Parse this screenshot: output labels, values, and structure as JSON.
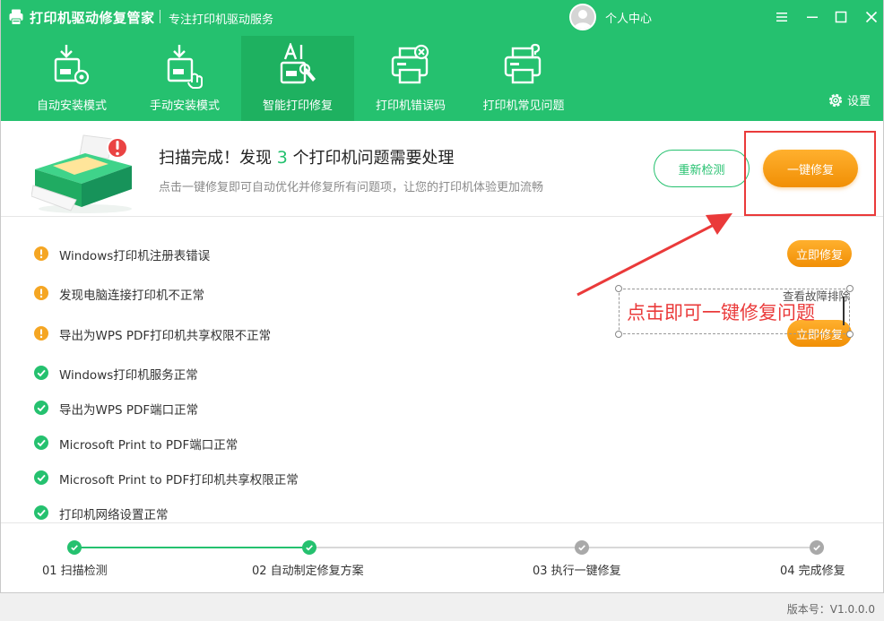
{
  "app": {
    "title": "打印机驱动修复管家",
    "subtitle": "专注打印机驱动服务",
    "user_label": "个人中心",
    "settings_label": "设置",
    "version_label": "版本号：V1.0.0.0"
  },
  "nav": {
    "tabs": [
      {
        "label": "自动安装模式",
        "icon": "auto-install-icon"
      },
      {
        "label": "手动安装模式",
        "icon": "manual-install-icon"
      },
      {
        "label": "智能打印修复",
        "icon": "ai-repair-icon",
        "active": true
      },
      {
        "label": "打印机错误码",
        "icon": "printer-error-icon"
      },
      {
        "label": "打印机常见问题",
        "icon": "printer-faq-icon"
      }
    ]
  },
  "summary": {
    "title_prefix": "扫描完成！发现",
    "issue_count": "3",
    "title_suffix": "个打印机问题需要处理",
    "subtitle": "点击一键修复即可自动优化并修复所有问题项，让您的打印机体验更加流畅",
    "rescan_label": "重新检测",
    "onekey_label": "一键修复"
  },
  "issues": [
    {
      "text": "Windows打印机注册表错误",
      "status": "warning"
    },
    {
      "text": "发现电脑连接打印机不正常",
      "status": "warning"
    },
    {
      "text": "导出为WPS PDF打印机共享权限不正常",
      "status": "warning"
    },
    {
      "text": "Windows打印机服务正常",
      "status": "ok"
    },
    {
      "text": "导出为WPS PDF端口正常",
      "status": "ok"
    },
    {
      "text": "Microsoft Print to PDF端口正常",
      "status": "ok"
    },
    {
      "text": "Microsoft Print to PDF打印机共享权限正常",
      "status": "ok"
    },
    {
      "text": "打印机网络设置正常",
      "status": "ok"
    }
  ],
  "issue_actions": {
    "fix_label": "立即修复",
    "troubleshoot_label": "查看故障排除"
  },
  "annotation": {
    "text": "点击即可一键修复问题"
  },
  "steps": [
    {
      "label": "01 扫描检测",
      "done": true
    },
    {
      "label": "02 自动制定修复方案",
      "done": true
    },
    {
      "label": "03 执行一键修复",
      "done": false
    },
    {
      "label": "04 完成修复",
      "done": false
    }
  ],
  "colors": {
    "brand_green": "#25c16f",
    "active_tab": "#1eb160",
    "orange": "#f5a011",
    "warning": "#f5a623",
    "annotation_red": "#ea3a3a"
  }
}
